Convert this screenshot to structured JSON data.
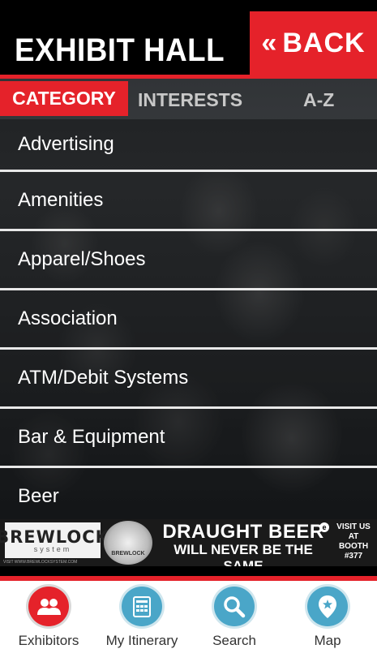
{
  "header": {
    "title": "EXHIBIT HALL",
    "back_label": "BACK",
    "back_icon": "chevron-double-left-icon"
  },
  "tabs": [
    {
      "label": "CATEGORY",
      "active": true
    },
    {
      "label": "INTERESTS",
      "active": false
    },
    {
      "label": "A-Z",
      "active": false
    }
  ],
  "categories": [
    {
      "label": "Advertising"
    },
    {
      "label": "Amenities"
    },
    {
      "label": "Apparel/Shoes"
    },
    {
      "label": "Association"
    },
    {
      "label": "ATM/Debit Systems"
    },
    {
      "label": "Bar & Equipment"
    },
    {
      "label": "Beer"
    }
  ],
  "banner": {
    "brand": "BREWLOCK",
    "brand_sub": "system",
    "gauge_label": "BREWLOCK",
    "line1": "DRAUGHT BEER",
    "line2": "WILL NEVER BE THE SAME",
    "booth_line1": "VISIT US AT",
    "booth_line2": "BOOTH",
    "booth_line3": "#377",
    "footnote": "VISIT WWW.BREWLOCKSYSTEM.COM"
  },
  "nav": [
    {
      "label": "Exhibitors",
      "icon": "people-icon",
      "active": true
    },
    {
      "label": "My Itinerary",
      "icon": "calendar-icon",
      "active": false
    },
    {
      "label": "Search",
      "icon": "search-icon",
      "active": false
    },
    {
      "label": "Map",
      "icon": "map-pin-icon",
      "active": false
    }
  ],
  "colors": {
    "accent": "#e5222a",
    "nav_blue": "#4aa6c8"
  }
}
